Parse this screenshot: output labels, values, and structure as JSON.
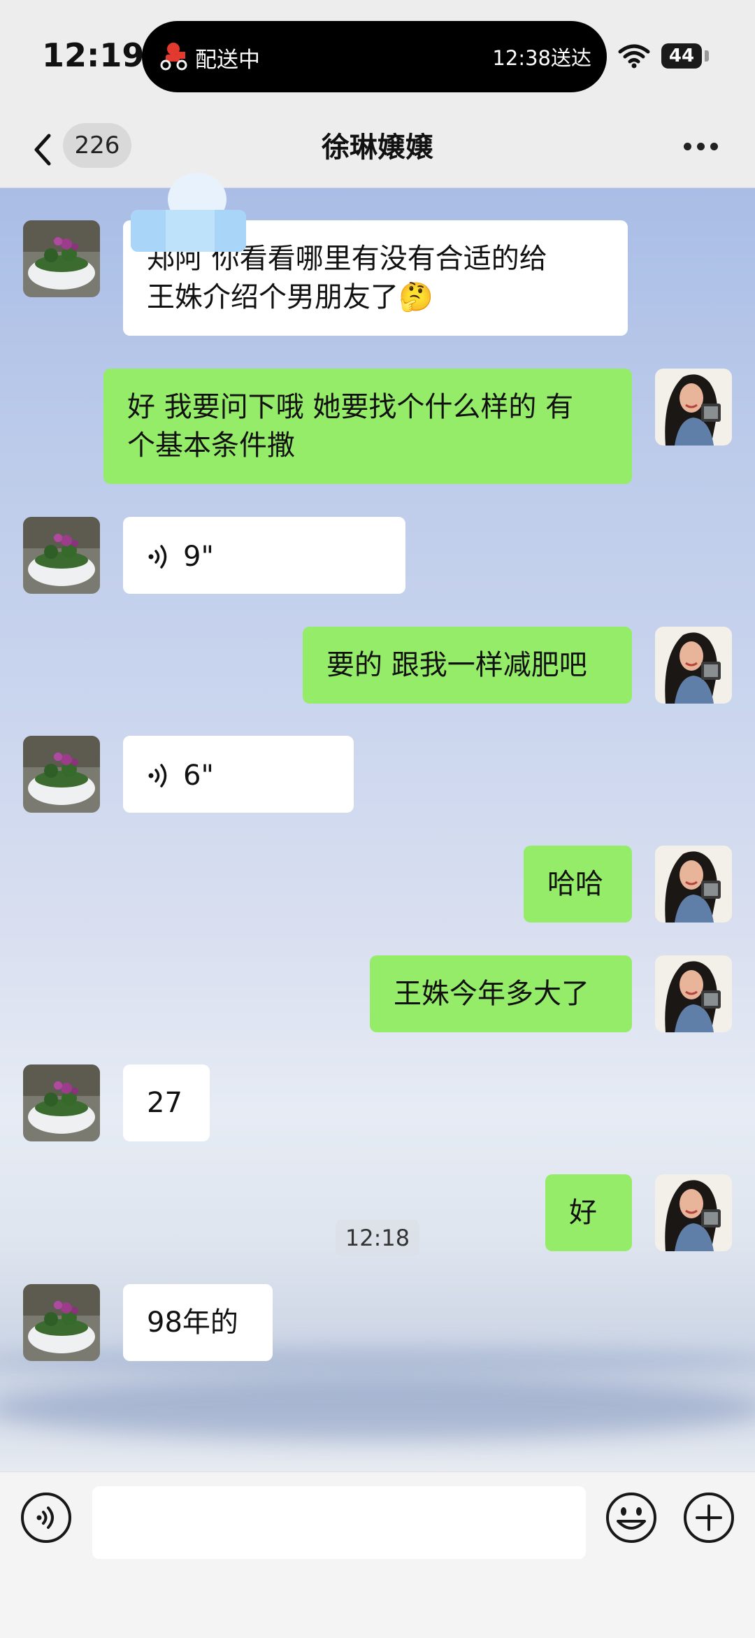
{
  "status_bar": {
    "time": "12:19",
    "island_left": "配送中",
    "island_right": "12:38送达",
    "battery": "44"
  },
  "nav": {
    "back_badge": "226",
    "title": "徐琳嬢嬢"
  },
  "messages": [
    {
      "side": "in",
      "type": "text",
      "lines": [
        "郑阿 你看看哪里有没有合适的给",
        "王姝介绍个男朋友了🤔"
      ]
    },
    {
      "side": "out",
      "type": "text",
      "lines": [
        "好 我要问下哦 她要找个什么样的 有",
        "个基本条件撒"
      ]
    },
    {
      "side": "in",
      "type": "voice",
      "duration": "9\""
    },
    {
      "side": "out",
      "type": "text",
      "lines": [
        "要的 跟我一样减肥吧"
      ]
    },
    {
      "side": "in",
      "type": "voice",
      "duration": "6\""
    },
    {
      "side": "out",
      "type": "text",
      "lines": [
        "哈哈"
      ]
    },
    {
      "side": "out",
      "type": "text",
      "lines": [
        "王姝今年多大了"
      ]
    },
    {
      "side": "in",
      "type": "text",
      "lines": [
        "27"
      ]
    },
    {
      "side": "out",
      "type": "text",
      "lines": [
        "好"
      ]
    },
    {
      "side": "in",
      "type": "text",
      "lines": [
        "98年的"
      ]
    }
  ],
  "timestamp": "12:18",
  "input": {
    "placeholder": ""
  },
  "colors": {
    "outgoing_bubble": "#95ec69",
    "incoming_bubble": "#ffffff",
    "bar_background": "#ededed"
  },
  "icons": [
    "delivery-rider-icon",
    "wifi-icon",
    "back-arrow-icon",
    "more-icon",
    "voice-wave-icon",
    "voice-input-icon",
    "emoji-icon",
    "plus-icon"
  ]
}
